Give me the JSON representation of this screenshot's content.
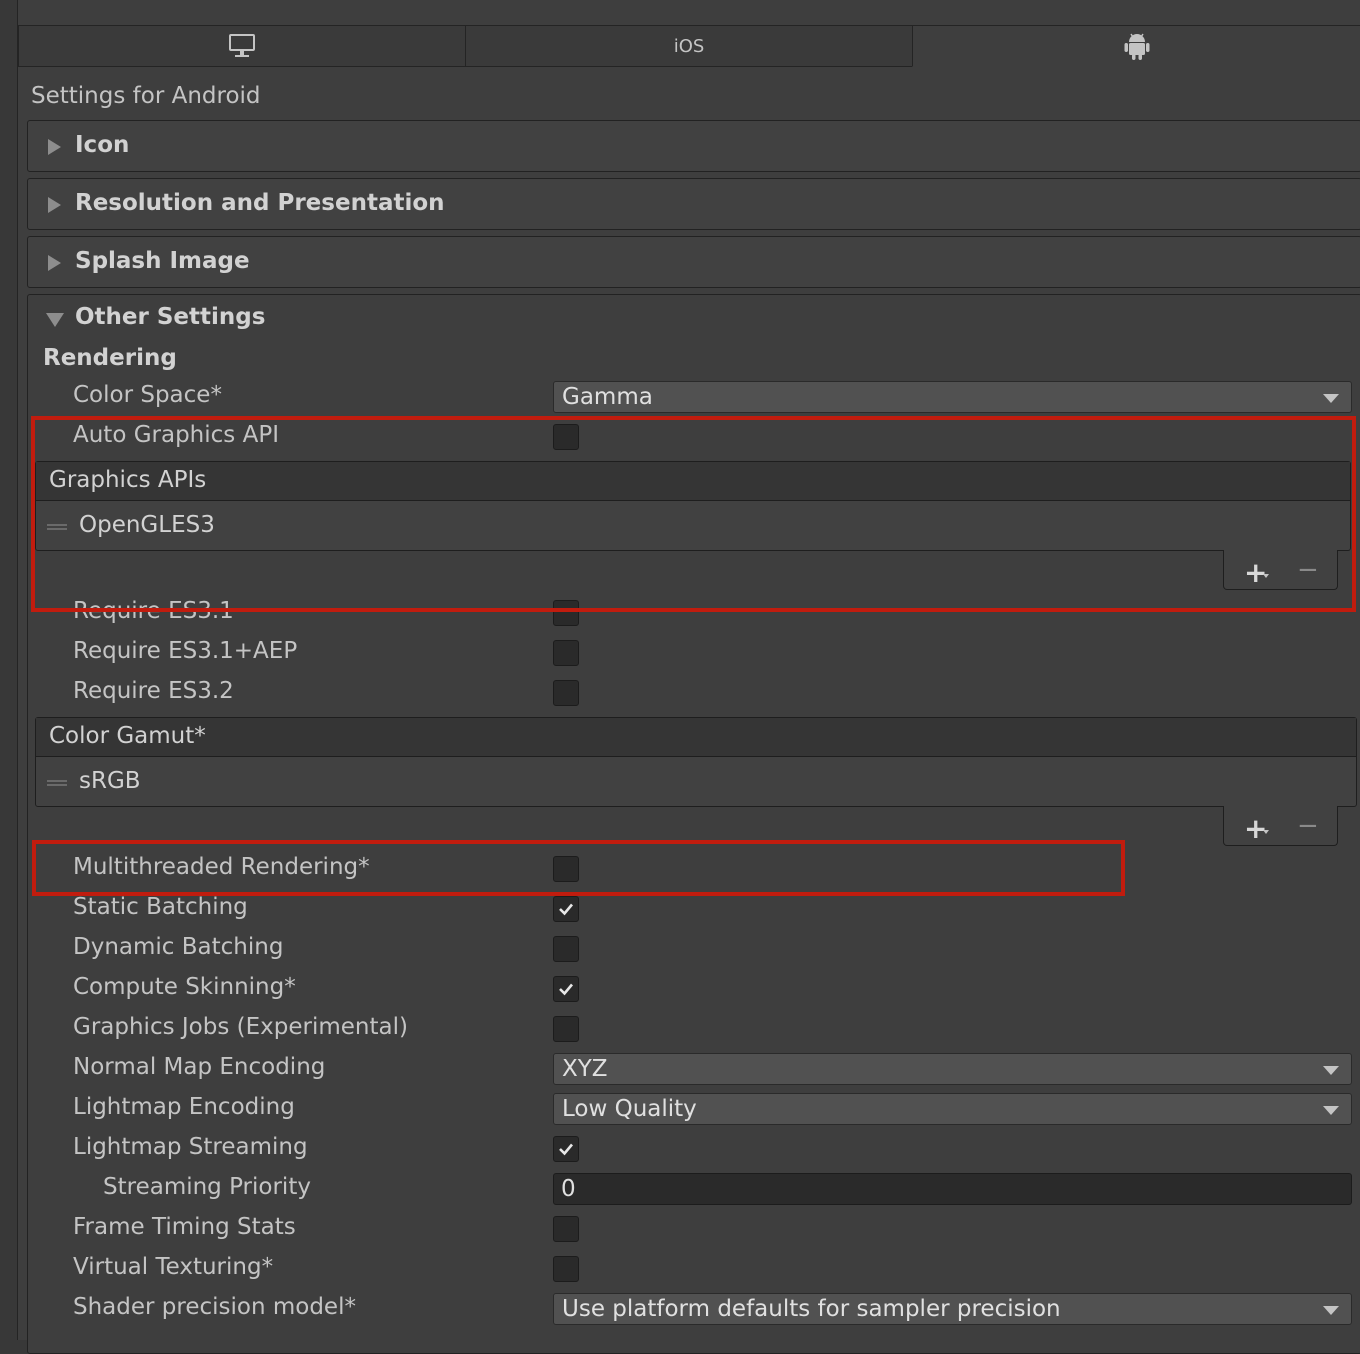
{
  "tabs": [
    {
      "icon": "monitor-icon",
      "label": ""
    },
    {
      "icon": "",
      "label": "iOS"
    },
    {
      "icon": "android-icon",
      "label": ""
    }
  ],
  "settings_title": "Settings for Android",
  "foldouts": {
    "icon": "Icon",
    "resolution": "Resolution and Presentation",
    "splash": "Splash Image",
    "other": "Other Settings"
  },
  "rendering": {
    "heading": "Rendering",
    "color_space": {
      "label": "Color Space*",
      "value": "Gamma"
    },
    "auto_graphics_api": {
      "label": "Auto Graphics API",
      "checked": false
    },
    "graphics_apis": {
      "header": "Graphics APIs",
      "items": [
        "OpenGLES3"
      ]
    },
    "require_es31": {
      "label": "Require ES3.1",
      "checked": false
    },
    "require_es31_aep": {
      "label": "Require ES3.1+AEP",
      "checked": false
    },
    "require_es32": {
      "label": "Require ES3.2",
      "checked": false
    },
    "color_gamut": {
      "header": "Color Gamut*",
      "items": [
        "sRGB"
      ]
    },
    "multithreaded_rendering": {
      "label": "Multithreaded Rendering*",
      "checked": false
    },
    "static_batching": {
      "label": "Static Batching",
      "checked": true
    },
    "dynamic_batching": {
      "label": "Dynamic Batching",
      "checked": false
    },
    "compute_skinning": {
      "label": "Compute Skinning*",
      "checked": true
    },
    "graphics_jobs": {
      "label": "Graphics Jobs (Experimental)",
      "checked": false
    },
    "normal_map_encoding": {
      "label": "Normal Map Encoding",
      "value": "XYZ"
    },
    "lightmap_encoding": {
      "label": "Lightmap Encoding",
      "value": "Low Quality"
    },
    "lightmap_streaming": {
      "label": "Lightmap Streaming",
      "checked": true
    },
    "streaming_priority": {
      "label": "Streaming Priority",
      "value": "0"
    },
    "frame_timing_stats": {
      "label": "Frame Timing Stats",
      "checked": false
    },
    "virtual_texturing": {
      "label": "Virtual Texturing*",
      "checked": false
    },
    "shader_precision": {
      "label": "Shader precision model*",
      "value": "Use platform defaults for sampler precision"
    }
  },
  "list_controls": {
    "plus": "+",
    "minus": "−"
  },
  "colors": {
    "highlight": "#c11c0e",
    "background": "#3e3e3e"
  }
}
